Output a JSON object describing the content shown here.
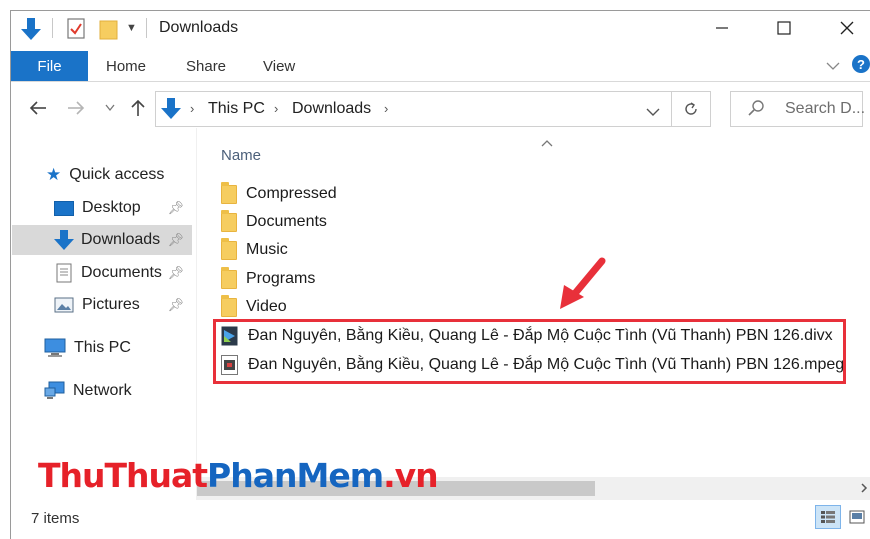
{
  "window": {
    "title": "Downloads",
    "min_glyph": "—",
    "max_glyph": "☐",
    "close_glyph": "✕"
  },
  "ribbon": {
    "tabs": [
      "File",
      "Home",
      "Share",
      "View"
    ]
  },
  "address_bar": {
    "crumbs": [
      "This PC",
      "Downloads"
    ],
    "search_placeholder": "Search D..."
  },
  "nav_pane": {
    "quick_access": "Quick access",
    "items": [
      {
        "label": "Desktop",
        "icon": "desktop-icon",
        "pinned": true,
        "selected": false
      },
      {
        "label": "Downloads",
        "icon": "download-arrow-icon",
        "pinned": true,
        "selected": true
      },
      {
        "label": "Documents",
        "icon": "document-icon",
        "pinned": true,
        "selected": false
      },
      {
        "label": "Pictures",
        "icon": "pictures-icon",
        "pinned": true,
        "selected": false
      }
    ],
    "this_pc": "This PC",
    "network": "Network"
  },
  "file_list": {
    "column_name": "Name",
    "folders": [
      "Compressed",
      "Documents",
      "Music",
      "Programs",
      "Video"
    ],
    "files": [
      {
        "name": "Đan Nguyên, Bằng Kiều, Quang Lê - Đắp Mộ Cuộc Tình (Vũ Thanh) PBN 126.divx",
        "icon": "divx-file-icon"
      },
      {
        "name": "Đan Nguyên, Bằng Kiều, Quang Lê - Đắp Mộ Cuộc Tình (Vũ Thanh) PBN 126.mpeg",
        "icon": "mpeg-file-icon"
      }
    ]
  },
  "status": {
    "item_count": "7 items"
  },
  "watermark": {
    "part1": "ThuThuat",
    "part2": "PhanMem",
    "part3": ".vn"
  },
  "colors": {
    "accent": "#1a73c8",
    "highlight_box": "#e8303a",
    "folder": "#f6cd60"
  }
}
